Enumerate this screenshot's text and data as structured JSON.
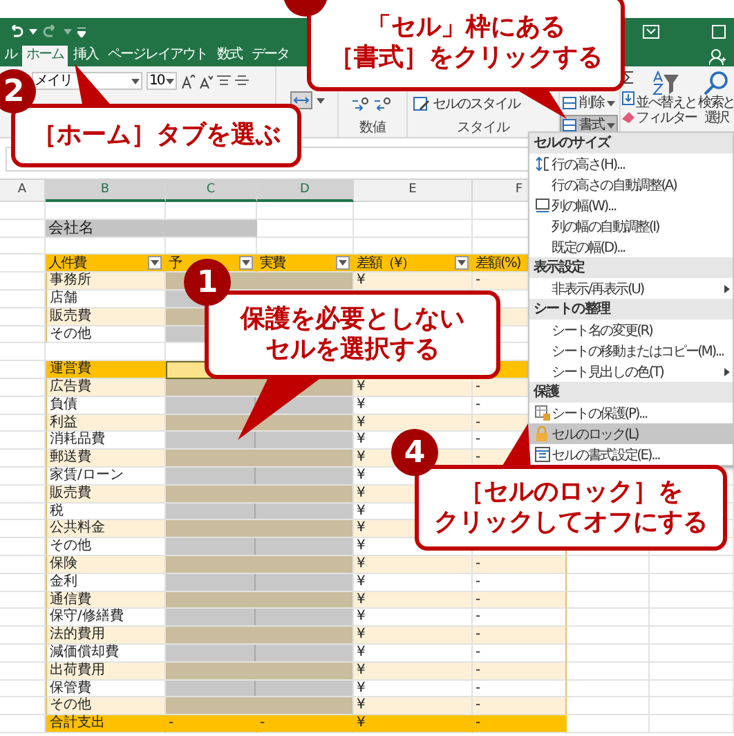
{
  "ribbon_tabs": [
    {
      "label": "ル",
      "selected": false
    },
    {
      "label": "ホーム",
      "selected": true
    },
    {
      "label": "挿入",
      "selected": false
    },
    {
      "label": "ページレイアウト",
      "selected": false
    },
    {
      "label": "数式",
      "selected": false
    },
    {
      "label": "データ",
      "selected": false
    }
  ],
  "ribbon": {
    "font_name": "メイリ",
    "font_size": "10",
    "number_label": "数値",
    "style_button": "セルのスタイル",
    "style_label": "スタイル",
    "cell_buttons": [
      {
        "label": "削除",
        "selected": false
      },
      {
        "label": "書式",
        "selected": true
      }
    ],
    "editing_buttons": [
      {
        "lines": [
          "並べ替えと",
          "フィルター"
        ]
      },
      {
        "lines": [
          "検索と",
          "選択"
        ]
      }
    ]
  },
  "columns": [
    {
      "label": "A",
      "selected": false
    },
    {
      "label": "B",
      "selected": true
    },
    {
      "label": "C",
      "selected": true
    },
    {
      "label": "D",
      "selected": true
    },
    {
      "label": "E",
      "selected": false
    },
    {
      "label": "F",
      "selected": false
    }
  ],
  "rows": [
    {
      "kind": "blank"
    },
    {
      "kind": "title",
      "label": "会社名"
    },
    {
      "kind": "blank"
    },
    {
      "kind": "header",
      "cells": [
        "人件費",
        "予",
        "実費",
        "差額（¥）",
        "差額(%)"
      ]
    },
    {
      "kind": "data",
      "label": "事務所",
      "selected": true,
      "e": "¥",
      "f": "-"
    },
    {
      "kind": "data",
      "label": "店舗",
      "selected": true
    },
    {
      "kind": "data",
      "label": "販売費",
      "selected": true
    },
    {
      "kind": "data",
      "label": "その他",
      "selected": true
    },
    {
      "kind": "blank"
    },
    {
      "kind": "section",
      "label": "運営費",
      "selected": true
    },
    {
      "kind": "data",
      "label": "広告費",
      "selected": true,
      "e": "¥",
      "f": "-"
    },
    {
      "kind": "data",
      "label": "負債",
      "selected": true,
      "e": "¥",
      "f": "-"
    },
    {
      "kind": "data",
      "label": "利益",
      "selected": true,
      "e": "¥",
      "f": "-"
    },
    {
      "kind": "data",
      "label": "消耗品費",
      "selected": true,
      "e": "¥",
      "f": "-"
    },
    {
      "kind": "data",
      "label": "郵送費",
      "selected": true,
      "e": "¥",
      "f": "-"
    },
    {
      "kind": "data",
      "label": "家賃/ローン",
      "selected": true,
      "e": "¥"
    },
    {
      "kind": "data",
      "label": "販売費",
      "selected": true,
      "e": "¥"
    },
    {
      "kind": "data",
      "label": "税",
      "selected": true,
      "e": "¥"
    },
    {
      "kind": "data",
      "label": "公共料金",
      "selected": true,
      "e": "¥"
    },
    {
      "kind": "data",
      "label": "その他",
      "selected": true,
      "e": "¥"
    },
    {
      "kind": "data",
      "label": "保険",
      "selected": true,
      "e": "¥",
      "f": "-"
    },
    {
      "kind": "data",
      "label": "金利",
      "selected": true,
      "e": "¥",
      "f": "-"
    },
    {
      "kind": "data",
      "label": "通信費",
      "selected": true,
      "e": "¥",
      "f": "-"
    },
    {
      "kind": "data",
      "label": "保守/修繕費",
      "selected": true,
      "e": "¥",
      "f": "-"
    },
    {
      "kind": "data",
      "label": "法的費用",
      "selected": true,
      "e": "¥",
      "f": "-"
    },
    {
      "kind": "data",
      "label": "減価償却費",
      "selected": true,
      "e": "¥",
      "f": "-"
    },
    {
      "kind": "data",
      "label": "出荷費用",
      "selected": true,
      "e": "¥",
      "f": "-"
    },
    {
      "kind": "data",
      "label": "保管費",
      "selected": true,
      "e": "¥",
      "f": "-"
    },
    {
      "kind": "data",
      "label": "その他",
      "selected": true,
      "e": "¥",
      "f": "-"
    },
    {
      "kind": "total",
      "label": "合計支出",
      "c": "-",
      "d": "-",
      "e": "¥",
      "f": "-"
    }
  ],
  "menu": {
    "sections": [
      {
        "title": "セルのサイズ",
        "items": [
          {
            "label": "行の高さ(H)...",
            "kind": "row",
            "selected": false,
            "submenu": false
          },
          {
            "label": "行の高さの自動調整(A)",
            "kind": "text",
            "selected": false,
            "submenu": false
          },
          {
            "label": "列の幅(W)...",
            "kind": "column",
            "selected": false,
            "submenu": false
          },
          {
            "label": "列の幅の自動調整(I)",
            "kind": "text",
            "selected": false,
            "submenu": false
          },
          {
            "label": "既定の幅(D)...",
            "kind": "text",
            "selected": false,
            "submenu": false
          }
        ]
      },
      {
        "title": "表示設定",
        "items": [
          {
            "label": "非表示/再表示(U)",
            "kind": "text",
            "selected": false,
            "submenu": true
          }
        ]
      },
      {
        "title": "シートの整理",
        "items": [
          {
            "label": "シート名の変更(R)",
            "kind": "text",
            "selected": false,
            "submenu": false
          },
          {
            "label": "シートの移動またはコピー(M)...",
            "kind": "text",
            "selected": false,
            "submenu": false
          },
          {
            "label": "シート見出しの色(T)",
            "kind": "text",
            "selected": false,
            "submenu": true
          }
        ]
      },
      {
        "title": "保護",
        "items": [
          {
            "label": "シートの保護(P)...",
            "kind": "sheet",
            "selected": false,
            "submenu": false
          },
          {
            "label": "セルのロック(L)",
            "kind": "lock",
            "selected": true,
            "submenu": false
          },
          {
            "label": "セルの書式設定(E)...",
            "kind": "format",
            "selected": false,
            "submenu": false
          }
        ]
      }
    ]
  },
  "callouts": [
    {
      "lines": [
        "「セル」枠にある",
        "［書式］をクリックする"
      ]
    },
    {
      "number": "2",
      "lines": [
        "［ホーム］タブを選ぶ"
      ]
    },
    {
      "number": "1",
      "lines": [
        "保護を必要としない",
        "セルを選択する"
      ]
    },
    {
      "number": "4",
      "lines": [
        "［セルのロック］を",
        "クリックしてオフにする"
      ]
    }
  ]
}
